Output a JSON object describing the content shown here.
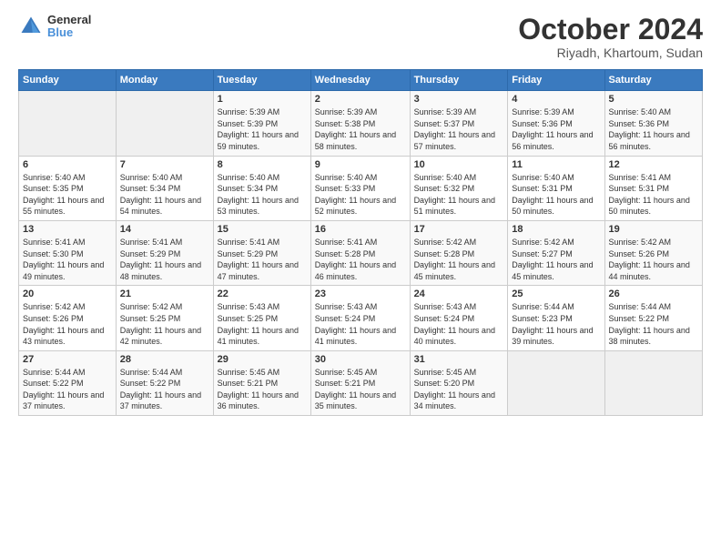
{
  "logo": {
    "line1": "General",
    "line2": "Blue"
  },
  "title": "October 2024",
  "subtitle": "Riyadh, Khartoum, Sudan",
  "days_header": [
    "Sunday",
    "Monday",
    "Tuesday",
    "Wednesday",
    "Thursday",
    "Friday",
    "Saturday"
  ],
  "weeks": [
    [
      {
        "day": "",
        "sunrise": "",
        "sunset": "",
        "daylight": ""
      },
      {
        "day": "",
        "sunrise": "",
        "sunset": "",
        "daylight": ""
      },
      {
        "day": "1",
        "sunrise": "Sunrise: 5:39 AM",
        "sunset": "Sunset: 5:39 PM",
        "daylight": "Daylight: 11 hours and 59 minutes."
      },
      {
        "day": "2",
        "sunrise": "Sunrise: 5:39 AM",
        "sunset": "Sunset: 5:38 PM",
        "daylight": "Daylight: 11 hours and 58 minutes."
      },
      {
        "day": "3",
        "sunrise": "Sunrise: 5:39 AM",
        "sunset": "Sunset: 5:37 PM",
        "daylight": "Daylight: 11 hours and 57 minutes."
      },
      {
        "day": "4",
        "sunrise": "Sunrise: 5:39 AM",
        "sunset": "Sunset: 5:36 PM",
        "daylight": "Daylight: 11 hours and 56 minutes."
      },
      {
        "day": "5",
        "sunrise": "Sunrise: 5:40 AM",
        "sunset": "Sunset: 5:36 PM",
        "daylight": "Daylight: 11 hours and 56 minutes."
      }
    ],
    [
      {
        "day": "6",
        "sunrise": "Sunrise: 5:40 AM",
        "sunset": "Sunset: 5:35 PM",
        "daylight": "Daylight: 11 hours and 55 minutes."
      },
      {
        "day": "7",
        "sunrise": "Sunrise: 5:40 AM",
        "sunset": "Sunset: 5:34 PM",
        "daylight": "Daylight: 11 hours and 54 minutes."
      },
      {
        "day": "8",
        "sunrise": "Sunrise: 5:40 AM",
        "sunset": "Sunset: 5:34 PM",
        "daylight": "Daylight: 11 hours and 53 minutes."
      },
      {
        "day": "9",
        "sunrise": "Sunrise: 5:40 AM",
        "sunset": "Sunset: 5:33 PM",
        "daylight": "Daylight: 11 hours and 52 minutes."
      },
      {
        "day": "10",
        "sunrise": "Sunrise: 5:40 AM",
        "sunset": "Sunset: 5:32 PM",
        "daylight": "Daylight: 11 hours and 51 minutes."
      },
      {
        "day": "11",
        "sunrise": "Sunrise: 5:40 AM",
        "sunset": "Sunset: 5:31 PM",
        "daylight": "Daylight: 11 hours and 50 minutes."
      },
      {
        "day": "12",
        "sunrise": "Sunrise: 5:41 AM",
        "sunset": "Sunset: 5:31 PM",
        "daylight": "Daylight: 11 hours and 50 minutes."
      }
    ],
    [
      {
        "day": "13",
        "sunrise": "Sunrise: 5:41 AM",
        "sunset": "Sunset: 5:30 PM",
        "daylight": "Daylight: 11 hours and 49 minutes."
      },
      {
        "day": "14",
        "sunrise": "Sunrise: 5:41 AM",
        "sunset": "Sunset: 5:29 PM",
        "daylight": "Daylight: 11 hours and 48 minutes."
      },
      {
        "day": "15",
        "sunrise": "Sunrise: 5:41 AM",
        "sunset": "Sunset: 5:29 PM",
        "daylight": "Daylight: 11 hours and 47 minutes."
      },
      {
        "day": "16",
        "sunrise": "Sunrise: 5:41 AM",
        "sunset": "Sunset: 5:28 PM",
        "daylight": "Daylight: 11 hours and 46 minutes."
      },
      {
        "day": "17",
        "sunrise": "Sunrise: 5:42 AM",
        "sunset": "Sunset: 5:28 PM",
        "daylight": "Daylight: 11 hours and 45 minutes."
      },
      {
        "day": "18",
        "sunrise": "Sunrise: 5:42 AM",
        "sunset": "Sunset: 5:27 PM",
        "daylight": "Daylight: 11 hours and 45 minutes."
      },
      {
        "day": "19",
        "sunrise": "Sunrise: 5:42 AM",
        "sunset": "Sunset: 5:26 PM",
        "daylight": "Daylight: 11 hours and 44 minutes."
      }
    ],
    [
      {
        "day": "20",
        "sunrise": "Sunrise: 5:42 AM",
        "sunset": "Sunset: 5:26 PM",
        "daylight": "Daylight: 11 hours and 43 minutes."
      },
      {
        "day": "21",
        "sunrise": "Sunrise: 5:42 AM",
        "sunset": "Sunset: 5:25 PM",
        "daylight": "Daylight: 11 hours and 42 minutes."
      },
      {
        "day": "22",
        "sunrise": "Sunrise: 5:43 AM",
        "sunset": "Sunset: 5:25 PM",
        "daylight": "Daylight: 11 hours and 41 minutes."
      },
      {
        "day": "23",
        "sunrise": "Sunrise: 5:43 AM",
        "sunset": "Sunset: 5:24 PM",
        "daylight": "Daylight: 11 hours and 41 minutes."
      },
      {
        "day": "24",
        "sunrise": "Sunrise: 5:43 AM",
        "sunset": "Sunset: 5:24 PM",
        "daylight": "Daylight: 11 hours and 40 minutes."
      },
      {
        "day": "25",
        "sunrise": "Sunrise: 5:44 AM",
        "sunset": "Sunset: 5:23 PM",
        "daylight": "Daylight: 11 hours and 39 minutes."
      },
      {
        "day": "26",
        "sunrise": "Sunrise: 5:44 AM",
        "sunset": "Sunset: 5:22 PM",
        "daylight": "Daylight: 11 hours and 38 minutes."
      }
    ],
    [
      {
        "day": "27",
        "sunrise": "Sunrise: 5:44 AM",
        "sunset": "Sunset: 5:22 PM",
        "daylight": "Daylight: 11 hours and 37 minutes."
      },
      {
        "day": "28",
        "sunrise": "Sunrise: 5:44 AM",
        "sunset": "Sunset: 5:22 PM",
        "daylight": "Daylight: 11 hours and 37 minutes."
      },
      {
        "day": "29",
        "sunrise": "Sunrise: 5:45 AM",
        "sunset": "Sunset: 5:21 PM",
        "daylight": "Daylight: 11 hours and 36 minutes."
      },
      {
        "day": "30",
        "sunrise": "Sunrise: 5:45 AM",
        "sunset": "Sunset: 5:21 PM",
        "daylight": "Daylight: 11 hours and 35 minutes."
      },
      {
        "day": "31",
        "sunrise": "Sunrise: 5:45 AM",
        "sunset": "Sunset: 5:20 PM",
        "daylight": "Daylight: 11 hours and 34 minutes."
      },
      {
        "day": "",
        "sunrise": "",
        "sunset": "",
        "daylight": ""
      },
      {
        "day": "",
        "sunrise": "",
        "sunset": "",
        "daylight": ""
      }
    ]
  ]
}
